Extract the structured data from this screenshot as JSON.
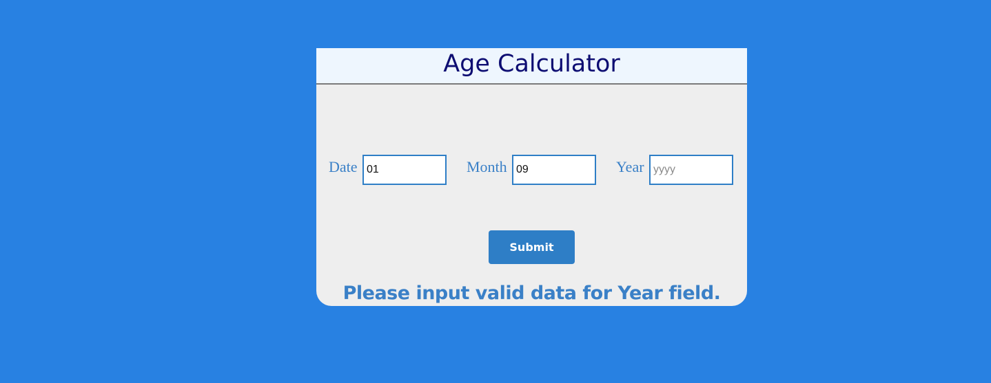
{
  "title": "Age Calculator",
  "fields": {
    "date": {
      "label": "Date",
      "value": "01",
      "placeholder": ""
    },
    "month": {
      "label": "Month",
      "value": "09",
      "placeholder": ""
    },
    "year": {
      "label": "Year",
      "value": "",
      "placeholder": "yyyy"
    }
  },
  "submit_label": "Submit",
  "error_message": "Please input valid data for Year field.",
  "colors": {
    "page_background": "#2881e2",
    "card_background": "#eeeeee",
    "header_background": "#eef6fe",
    "title_text": "#0d0d72",
    "accent": "#2e7ec6",
    "label_text": "#3a80c7"
  }
}
